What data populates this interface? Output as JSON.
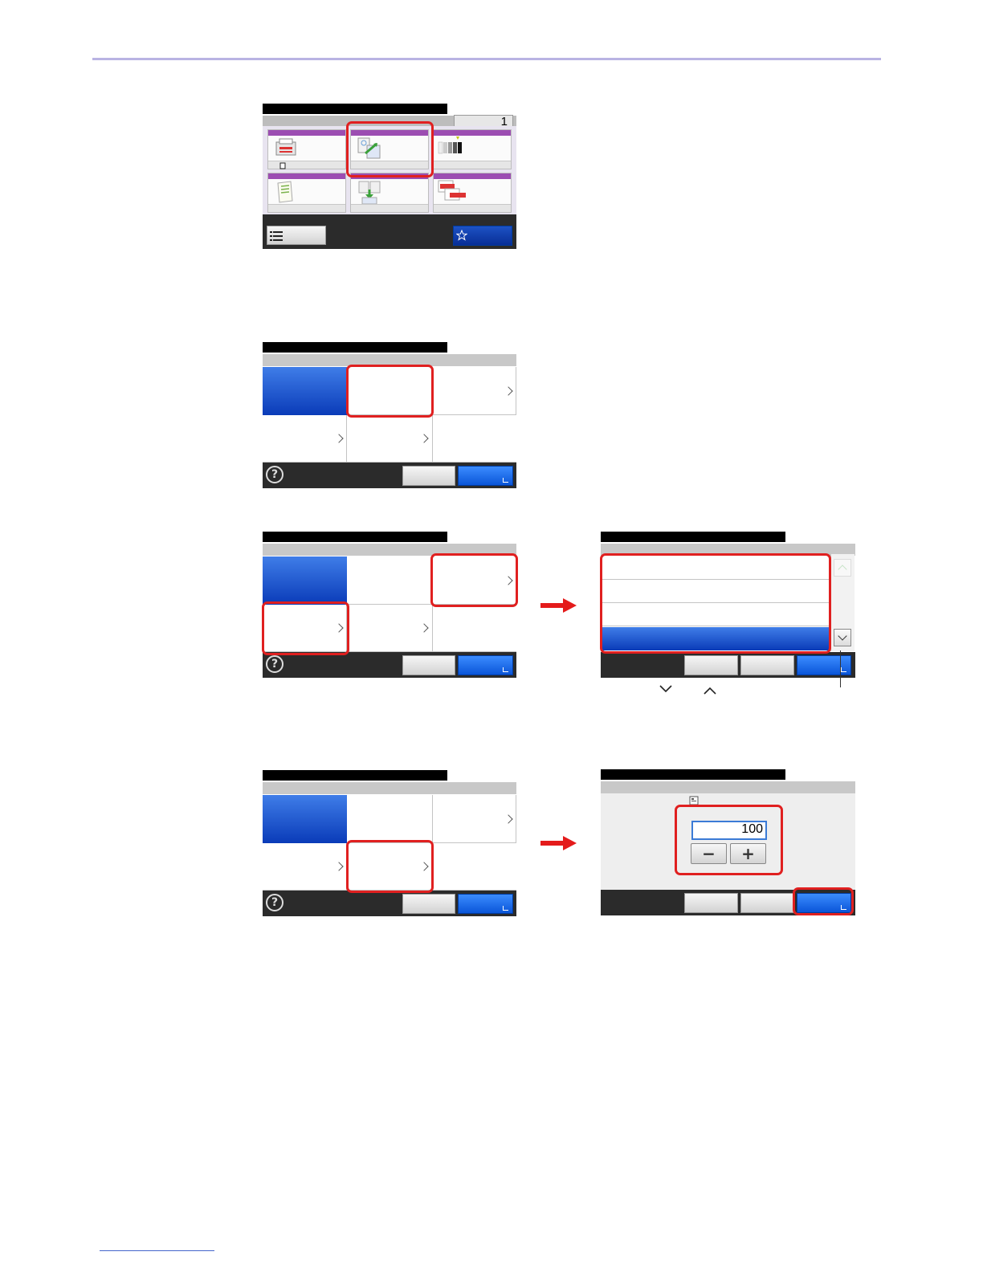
{
  "panel_home": {
    "copies": "1"
  },
  "step3_detail": {
    "scroll_down_symbol": "﹀",
    "scroll_up_symbol": "︿"
  },
  "panel_density": {
    "value": "100",
    "minus": "−",
    "plus": "+"
  },
  "common": {
    "help_symbol": "?"
  },
  "colors": {
    "highlight": "#e02020",
    "accent_blue": "#0a55d8",
    "function_band": "#9c4db2",
    "header_rule": "#b9b3e3"
  }
}
